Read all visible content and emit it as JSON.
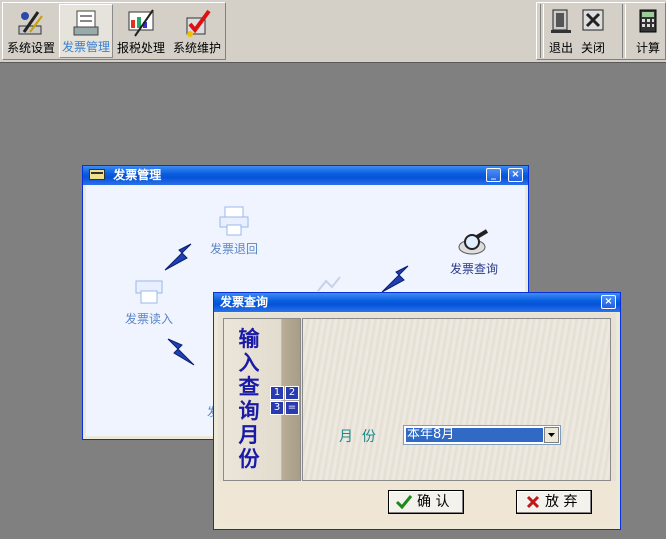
{
  "toolbar": {
    "items": [
      {
        "label": "系统设置",
        "icon": "pen-tools-icon"
      },
      {
        "label": "发票管理",
        "icon": "invoice-printer-icon"
      },
      {
        "label": "报税处理",
        "icon": "tax-report-icon"
      },
      {
        "label": "系统维护",
        "icon": "maintenance-check-icon"
      }
    ],
    "right_items": [
      {
        "label": "退出",
        "icon": "exit-icon"
      },
      {
        "label": "关闭",
        "icon": "close-x-icon"
      },
      {
        "label": "计算",
        "icon": "calculator-icon"
      }
    ]
  },
  "mgmt_window": {
    "title": "发票管理",
    "nodes": {
      "return": "发票退回",
      "query": "发票查询",
      "read": "发票读入",
      "partial": "发"
    }
  },
  "query_dialog": {
    "title": "发票查询",
    "side_label": [
      "输",
      "入",
      "查",
      "询",
      "月",
      "份"
    ],
    "month_label": "月  份",
    "month_value": "本年8月",
    "confirm": "确 认",
    "cancel": "放 弃",
    "keypad": [
      "1",
      "2",
      "3",
      "="
    ]
  },
  "colors": {
    "desktop": "#808080",
    "titlebar": "#0553d8",
    "accent_text": "#3b7fd0"
  }
}
